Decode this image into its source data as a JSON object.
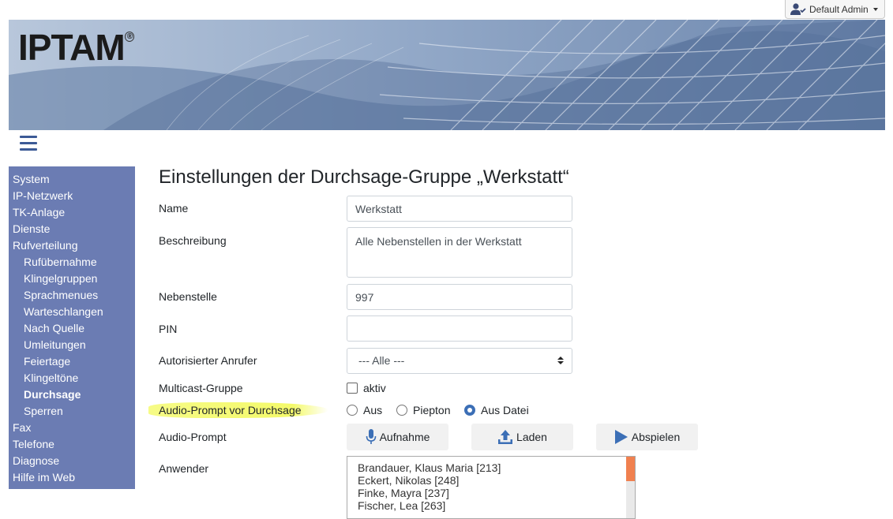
{
  "header": {
    "user_label": "Default Admin",
    "logo_text": "IPTAM",
    "logo_reg": "®"
  },
  "sidebar": {
    "items": [
      {
        "label": "System",
        "level": 0
      },
      {
        "label": "IP-Netzwerk",
        "level": 0
      },
      {
        "label": "TK-Anlage",
        "level": 0
      },
      {
        "label": "Dienste",
        "level": 0
      },
      {
        "label": "Rufverteilung",
        "level": 0
      },
      {
        "label": "Rufübernahme",
        "level": 1
      },
      {
        "label": "Klingelgruppen",
        "level": 1
      },
      {
        "label": "Sprachmenues",
        "level": 1
      },
      {
        "label": "Warteschlangen",
        "level": 1
      },
      {
        "label": "Nach Quelle",
        "level": 1
      },
      {
        "label": "Umleitungen",
        "level": 1
      },
      {
        "label": "Feiertage",
        "level": 1
      },
      {
        "label": "Klingeltöne",
        "level": 1
      },
      {
        "label": "Durchsage",
        "level": 1,
        "active": true
      },
      {
        "label": "Sperren",
        "level": 1
      },
      {
        "label": "Fax",
        "level": 0
      },
      {
        "label": "Telefone",
        "level": 0
      },
      {
        "label": "Diagnose",
        "level": 0
      },
      {
        "label": "Hilfe im Web",
        "level": 0
      }
    ]
  },
  "main": {
    "title": "Einstellungen der Durchsage-Gruppe „Werkstatt“",
    "name_label": "Name",
    "name_value": "Werkstatt",
    "description_label": "Beschreibung",
    "description_value": "Alle Nebenstellen in der Werkstatt",
    "extension_label": "Nebenstelle",
    "extension_value": "997",
    "pin_label": "PIN",
    "pin_value": "",
    "caller_label": "Autorisierter Anrufer",
    "caller_value": "--- Alle ---",
    "multicast_label": "Multicast-Gruppe",
    "multicast_checkbox_label": "aktiv",
    "multicast_checked": false,
    "prompt_before_label": "Audio-Prompt vor Durchsage",
    "prompt_options": [
      "Aus",
      "Piepton",
      "Aus Datei"
    ],
    "prompt_selected": "Aus Datei",
    "audio_prompt_label": "Audio-Prompt",
    "buttons": {
      "record": "Aufnahme",
      "load": "Laden",
      "play": "Abspielen"
    },
    "users_label": "Anwender",
    "users": [
      "Brandauer, Klaus Maria [213]",
      "Eckert, Nikolas [248]",
      "Finke, Mayra [237]",
      "Fischer, Lea [263]"
    ]
  },
  "colors": {
    "sidebar_bg": "#6b7cb3",
    "highlight": "#f4fa6a",
    "accent": "#3c6fb6",
    "scroll_thumb": "#f0804f"
  }
}
